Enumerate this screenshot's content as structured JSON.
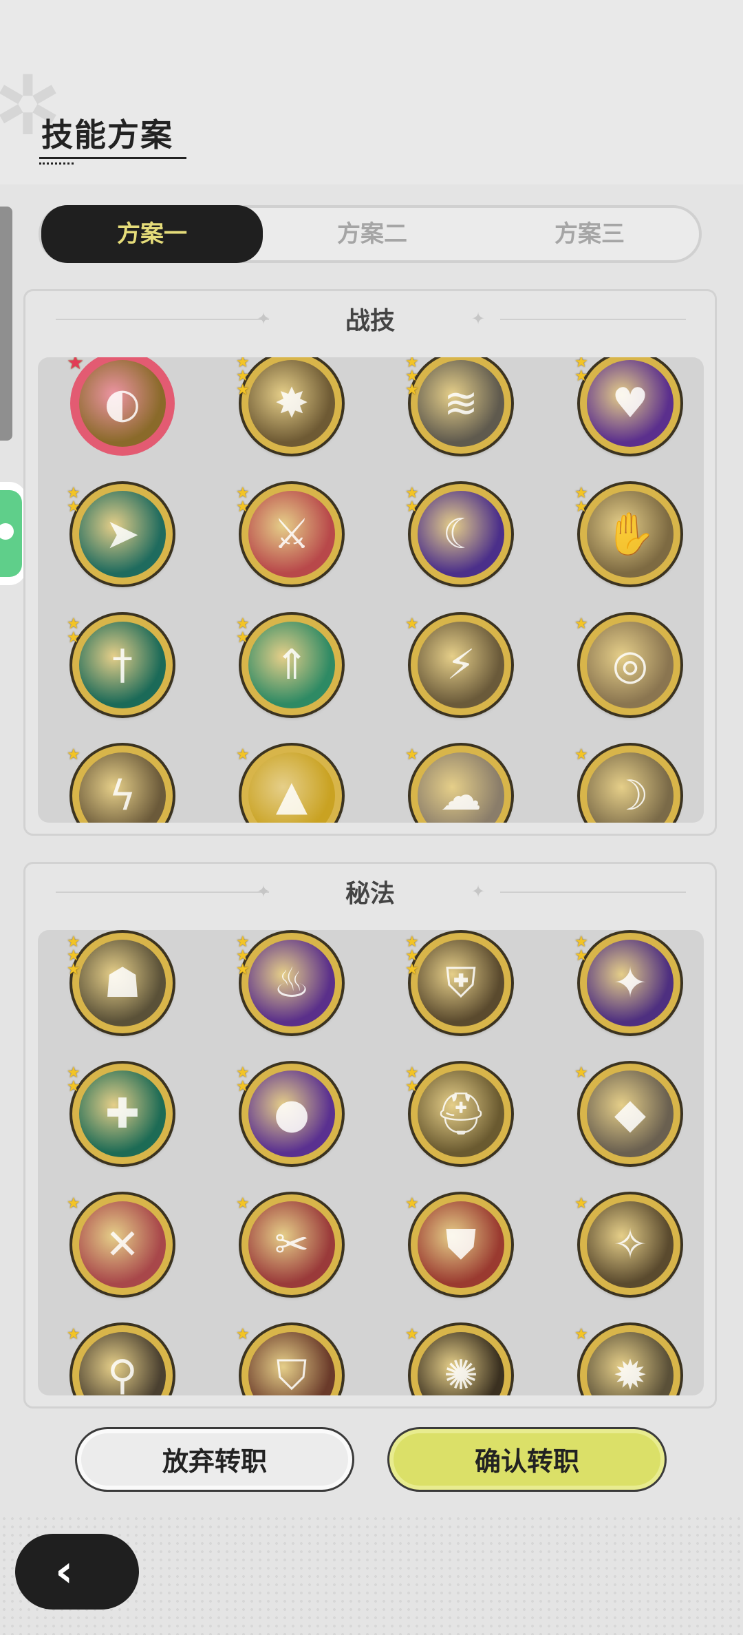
{
  "header": {
    "title": "技能方案"
  },
  "tabs": [
    {
      "label": "方案一",
      "active": true
    },
    {
      "label": "方案二",
      "active": false
    },
    {
      "label": "方案三",
      "active": false
    }
  ],
  "battle_skills": {
    "title": "战技",
    "items": [
      {
        "name": "golden-swirl-skill-icon",
        "stars": 1,
        "selected": true,
        "bg": "#8a6a2a",
        "glyph": "◐"
      },
      {
        "name": "burst-explosion-skill-icon",
        "stars": 3,
        "bg": "#6e5a34",
        "glyph": "✸"
      },
      {
        "name": "wind-slash-skill-icon",
        "stars": 3,
        "bg": "#5f5a4e",
        "glyph": "≋"
      },
      {
        "name": "purple-heart-skill-icon",
        "stars": 2,
        "bg": "#5b2f8d",
        "glyph": "♥"
      },
      {
        "name": "teal-dash-skill-icon",
        "stars": 2,
        "bg": "#1f6b5e",
        "glyph": "➤"
      },
      {
        "name": "red-sword-raise-skill-icon",
        "stars": 2,
        "bg": "#b8484a",
        "glyph": "⚔"
      },
      {
        "name": "purple-shadow-skill-icon",
        "stars": 2,
        "bg": "#4b2f8a",
        "glyph": "☾"
      },
      {
        "name": "reaching-hand-skill-icon",
        "stars": 2,
        "bg": "#7d6a42",
        "glyph": "✋"
      },
      {
        "name": "teal-greatsword-skill-icon",
        "stars": 2,
        "bg": "#1b6a58",
        "glyph": "†"
      },
      {
        "name": "green-arrows-skill-icon",
        "stars": 2,
        "bg": "#2e8a64",
        "glyph": "⇑"
      },
      {
        "name": "golden-blade-skill-icon",
        "stars": 1,
        "bg": "#6a5a3a",
        "glyph": "⚡"
      },
      {
        "name": "golden-whirl-skill-icon",
        "stars": 1,
        "bg": "#8a7550",
        "glyph": "◎"
      },
      {
        "name": "lightning-strike-skill-icon",
        "stars": 1,
        "bg": "#6b5a3a",
        "glyph": "ϟ"
      },
      {
        "name": "golden-crest-skill-icon",
        "stars": 1,
        "bg": "#c9a222",
        "glyph": "▲"
      },
      {
        "name": "smoke-cloud-skill-icon",
        "stars": 1,
        "bg": "#8a7d6a",
        "glyph": "☁"
      },
      {
        "name": "crescent-hand-skill-icon",
        "stars": 1,
        "bg": "#7a6a48",
        "glyph": "☽"
      }
    ]
  },
  "arcana": {
    "title": "秘法",
    "items": [
      {
        "name": "golem-arcana-icon",
        "stars": 3,
        "bg": "#5a5138",
        "glyph": "☗"
      },
      {
        "name": "purple-flame-arcana-icon",
        "stars": 3,
        "bg": "#5a2f8a",
        "glyph": "♨"
      },
      {
        "name": "golden-armor-arcana-icon",
        "stars": 3,
        "bg": "#5a4a2e",
        "glyph": "⛨"
      },
      {
        "name": "purple-wolf-arcana-icon",
        "stars": 2,
        "bg": "#4e2f80",
        "glyph": "✦"
      },
      {
        "name": "healing-plus-arcana-icon",
        "stars": 2,
        "bg": "#1d6b55",
        "glyph": "✚"
      },
      {
        "name": "purple-silhouette-arcana-icon",
        "stars": 2,
        "bg": "#5a3090",
        "glyph": "●"
      },
      {
        "name": "helmet-heal-arcana-icon",
        "stars": 2,
        "bg": "#6a5a30",
        "glyph": "⛑"
      },
      {
        "name": "crystal-shard-arcana-icon",
        "stars": 1,
        "bg": "#6a6050",
        "glyph": "◆"
      },
      {
        "name": "red-sword-arcana-icon",
        "stars": 1,
        "bg": "#a8474a",
        "glyph": "✕"
      },
      {
        "name": "red-slash-arcana-icon",
        "stars": 1,
        "bg": "#9a3a3a",
        "glyph": "✂"
      },
      {
        "name": "red-armor-arcana-icon",
        "stars": 1,
        "bg": "#9a3a30",
        "glyph": "⛊"
      },
      {
        "name": "golden-beast-arcana-icon",
        "stars": 1,
        "bg": "#5a4a2e",
        "glyph": "✧"
      },
      {
        "name": "stone-sword-arcana-icon",
        "stars": 1,
        "bg": "#4a4030",
        "glyph": "⚲"
      },
      {
        "name": "shield-crest-arcana-icon",
        "stars": 1,
        "bg": "#6a3a2a",
        "glyph": "⛉"
      },
      {
        "name": "shadow-burst-arcana-icon",
        "stars": 1,
        "bg": "#3a3020",
        "glyph": "✺"
      },
      {
        "name": "spark-aura-arcana-icon",
        "stars": 1,
        "bg": "#5a5038",
        "glyph": "✹"
      }
    ]
  },
  "actions": {
    "abandon_label": "放弃转职",
    "confirm_label": "确认转职"
  },
  "colors": {
    "accent": "#e5dc7a",
    "confirm": "#dbe068",
    "selected_ring": "#e35b72",
    "gold_ring": "#d8b54a"
  }
}
